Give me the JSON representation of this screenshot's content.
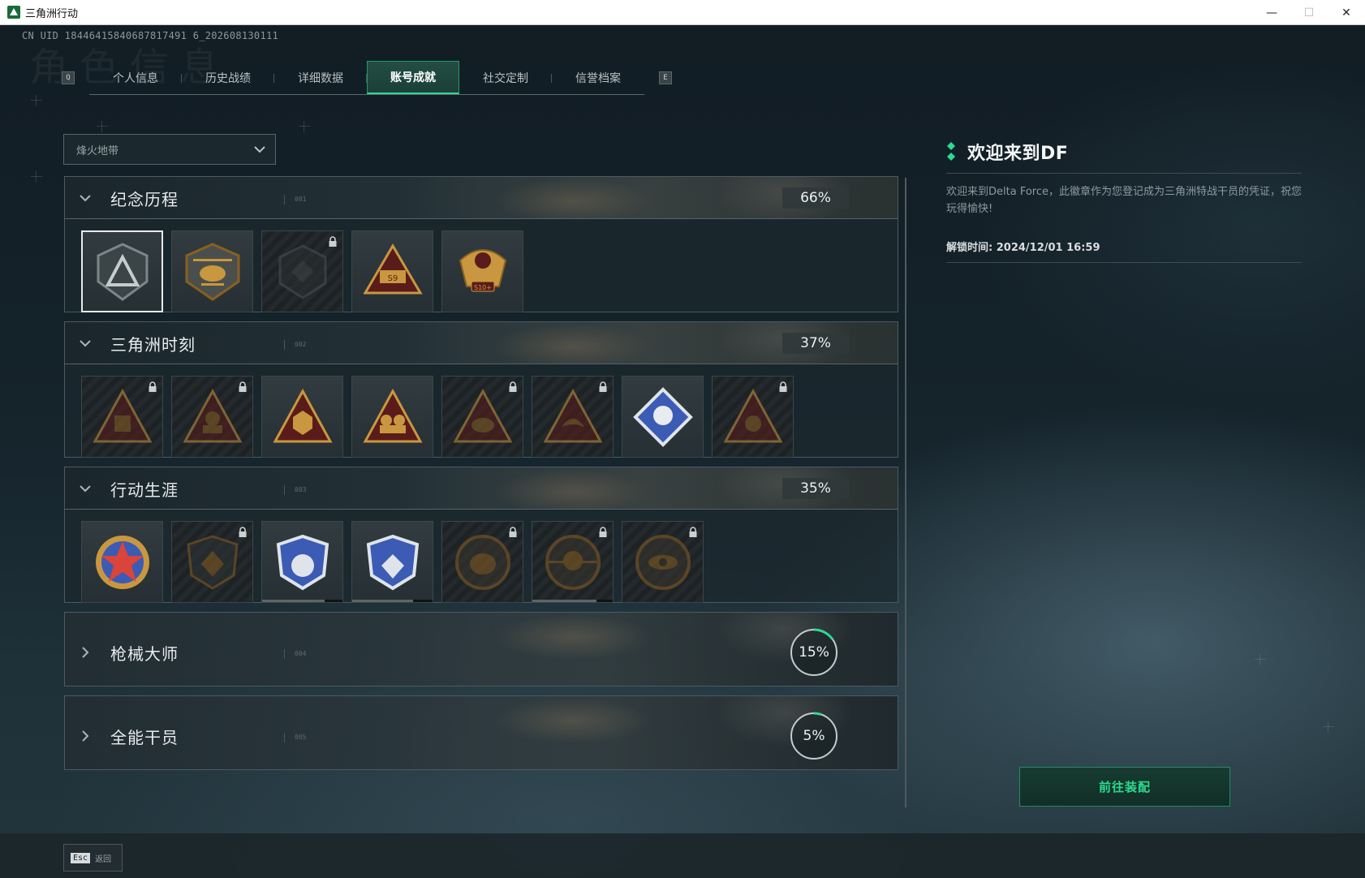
{
  "window": {
    "title": "三角洲行动",
    "minimize": "—",
    "maximize": "☐",
    "close": "✕"
  },
  "uid": "CN UID 18446415840687817491 6_202608130111",
  "bg_title": "角色信息",
  "tabs": {
    "left_key": "Q",
    "right_key": "E",
    "items": [
      {
        "label": "个人信息"
      },
      {
        "label": "历史战绩"
      },
      {
        "label": "详细数据"
      },
      {
        "label": "账号成就",
        "active": true
      },
      {
        "label": "社交定制"
      },
      {
        "label": "信誉档案"
      }
    ]
  },
  "mode_select": {
    "value": "烽火地带",
    "icon": "chevron-down-icon"
  },
  "categories": [
    {
      "title": "纪念历程",
      "num": "001",
      "percent": "66%",
      "expanded": true,
      "badges": [
        {
          "emblem": "delta-shield-emblem",
          "locked": false,
          "selected": true
        },
        {
          "emblem": "helicopter-emblem",
          "locked": false
        },
        {
          "emblem": "hex-crest-emblem",
          "locked": true
        },
        {
          "emblem": "tank-s9-emblem",
          "locked": false
        },
        {
          "emblem": "eagle-s10-emblem",
          "locked": false
        }
      ]
    },
    {
      "title": "三角洲时刻",
      "num": "002",
      "percent": "37%",
      "expanded": true,
      "badges": [
        {
          "emblem": "triangle-robot-emblem",
          "locked": true
        },
        {
          "emblem": "triangle-operator-emblem",
          "locked": true
        },
        {
          "emblem": "triangle-dice-emblem",
          "locked": false
        },
        {
          "emblem": "triangle-squad-emblem",
          "locked": false
        },
        {
          "emblem": "triangle-beast-emblem",
          "locked": true
        },
        {
          "emblem": "triangle-bird-emblem",
          "locked": true
        },
        {
          "emblem": "diamond-rose-emblem",
          "locked": false
        },
        {
          "emblem": "triangle-skull-emblem",
          "locked": true
        }
      ]
    },
    {
      "title": "行动生涯",
      "num": "003",
      "percent": "35%",
      "expanded": true,
      "badges": [
        {
          "emblem": "star-medal-emblem",
          "locked": false
        },
        {
          "emblem": "dark-shield-emblem",
          "locked": true
        },
        {
          "emblem": "blue-shield-emblem",
          "locked": false,
          "progress": 0.78
        },
        {
          "emblem": "blue-gem-shield-emblem",
          "locked": false,
          "progress": 0.76
        },
        {
          "emblem": "round-helmet-emblem",
          "locked": true
        },
        {
          "emblem": "round-skull-emblem",
          "locked": true,
          "progress": 0.8
        },
        {
          "emblem": "round-eye-emblem",
          "locked": true
        }
      ]
    },
    {
      "title": "枪械大师",
      "num": "004",
      "percent": "15%",
      "percent_value": 0.15,
      "expanded": false
    },
    {
      "title": "全能干员",
      "num": "005",
      "percent": "5%",
      "percent_value": 0.05,
      "expanded": false
    }
  ],
  "detail": {
    "title": "欢迎来到DF",
    "description": "欢迎来到Delta Force，此徽章作为您登记成为三角洲特战干员的凭证，祝您玩得愉快!",
    "unlock_label": "解锁时间: 2024/12/01 16:59"
  },
  "equip_button": "前往装配",
  "esc": {
    "key": "Esc",
    "label": "返回"
  },
  "colors": {
    "accent_green": "#2bdc8f",
    "tab_active_border": "#35d39a",
    "badge_gold": "#c9973f",
    "badge_blue": "#3b5bb5",
    "badge_red": "#5a1c1a"
  }
}
